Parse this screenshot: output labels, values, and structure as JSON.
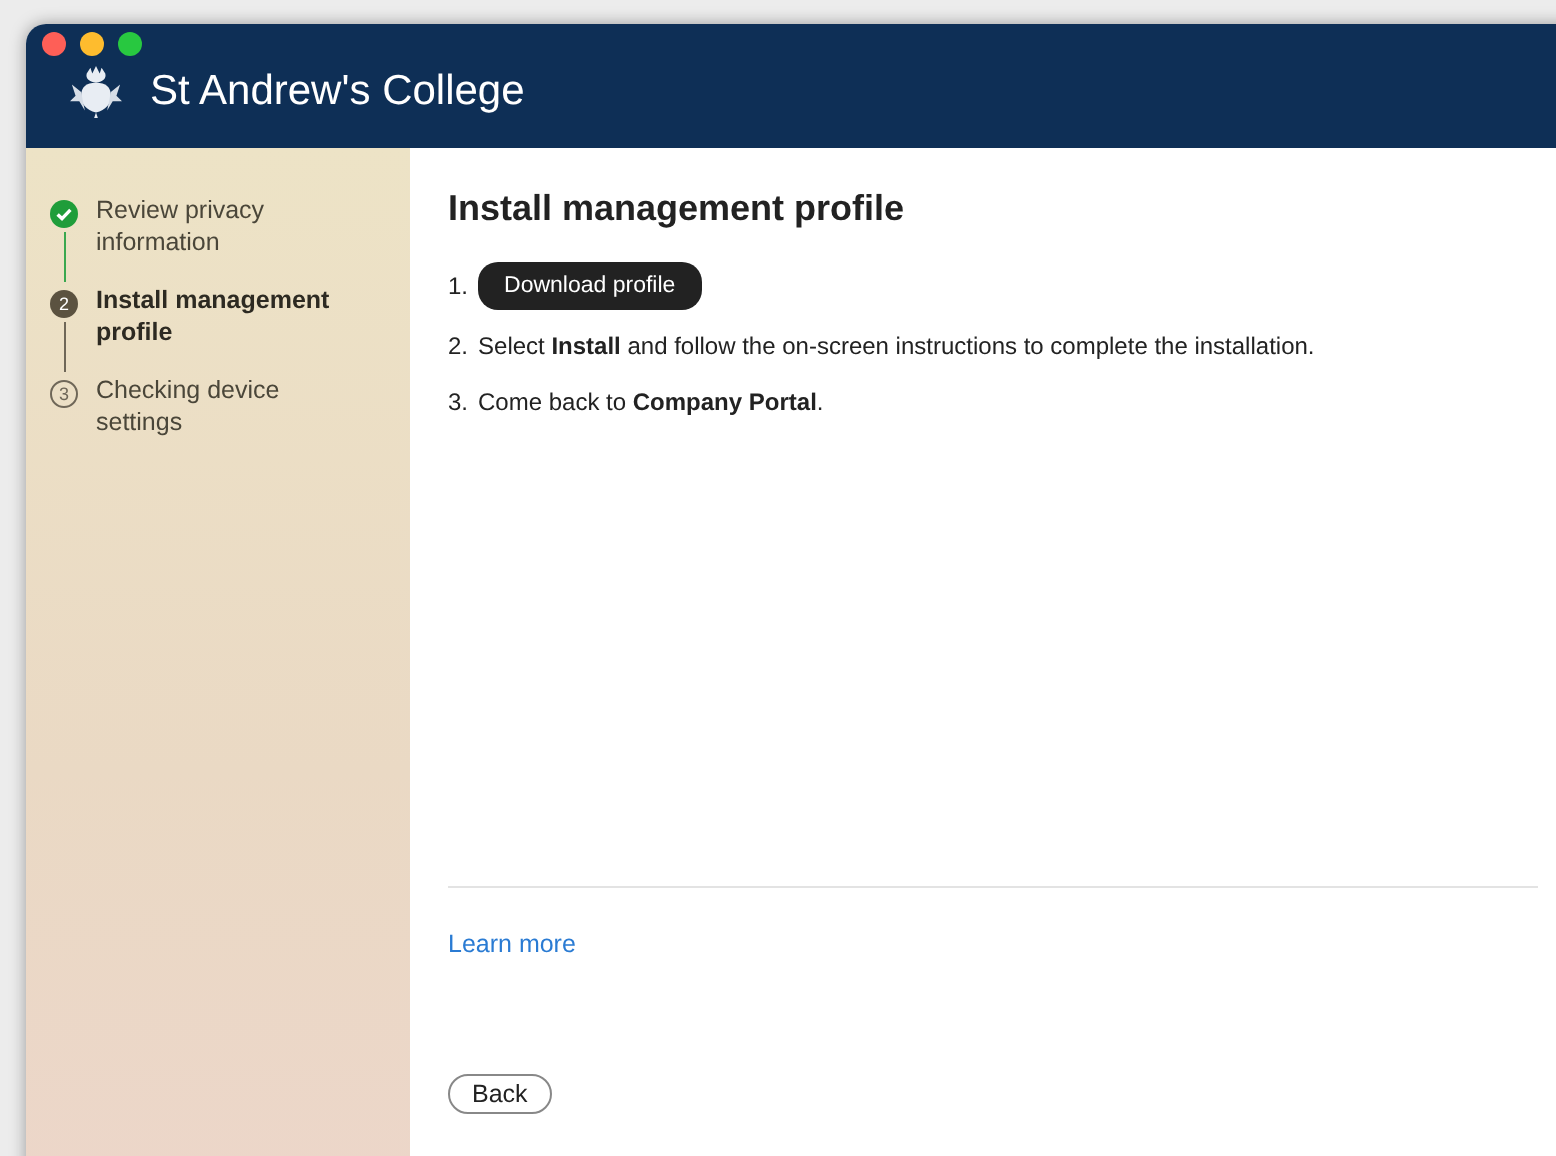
{
  "window": {
    "title": "St Andrew's College"
  },
  "steps": [
    {
      "label": "Review privacy information",
      "completed": true,
      "selected": false
    },
    {
      "label": "Install management profile",
      "completed": false,
      "selected": true,
      "number": "2"
    },
    {
      "label": "Checking device settings",
      "completed": false,
      "selected": false,
      "number": "3"
    }
  ],
  "heading": "Install management profile",
  "instructions": [
    {
      "number": "1.",
      "kind": "button",
      "label": "Download profile"
    },
    {
      "number": "2.",
      "kind": "text",
      "text": "Select **Install** and follow the on-screen instructions to complete the installation."
    },
    {
      "number": "3.",
      "kind": "text",
      "text": "Come back to **Company Portal**."
    }
  ],
  "link": "Learn more",
  "back_button": "Back"
}
